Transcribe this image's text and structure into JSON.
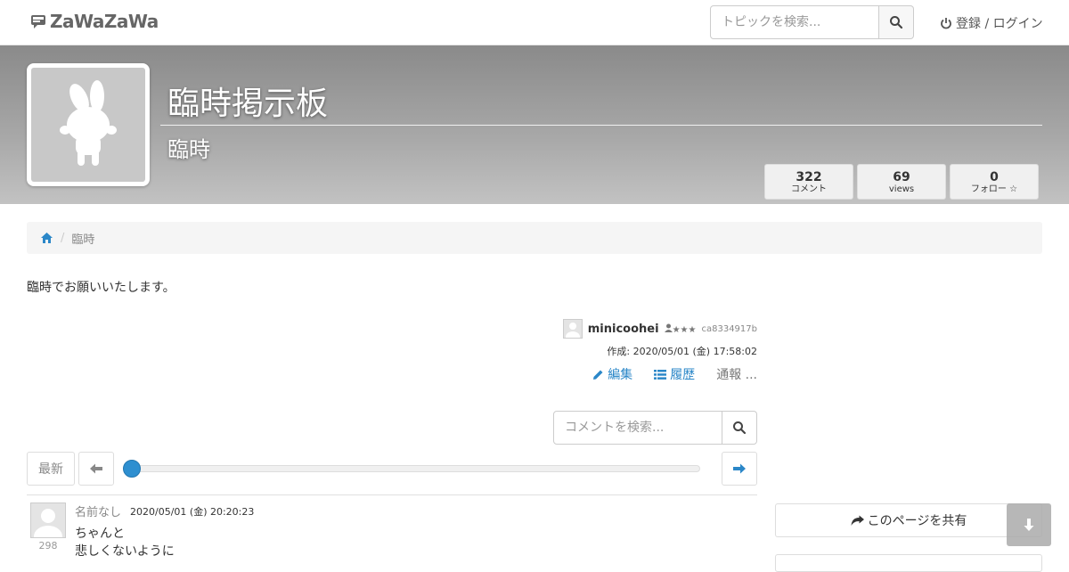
{
  "nav": {
    "logo_text": "ZaWaZaWa",
    "search_placeholder": "トピックを検索...",
    "login_label": "登録 / ログイン"
  },
  "board": {
    "title": "臨時掲示板",
    "subtitle": "臨時",
    "stats": [
      {
        "value": "322",
        "label": "コメント"
      },
      {
        "value": "69",
        "label": "views"
      },
      {
        "value": "0",
        "label": "フォロー ☆"
      }
    ]
  },
  "breadcrumb": {
    "current": "臨時"
  },
  "description": "臨時でお願いいたします。",
  "creator": {
    "name": "minicoohei",
    "rank": "★★★",
    "id": "ca8334917b",
    "created": "作成: 2020/05/01 (金) 17:58:02"
  },
  "actions": {
    "edit": "編集",
    "history": "履歴",
    "report": "通報 ..."
  },
  "comment_search": {
    "placeholder": "コメントを検索..."
  },
  "pager": {
    "latest_label": "最新",
    "position": 0
  },
  "comment": {
    "number": "298",
    "name": "名前なし",
    "date": "2020/05/01 (金) 20:20:23",
    "lines": [
      "ちゃんと",
      "悲しくないように"
    ]
  },
  "sidebar": {
    "share_label": "このページを共有"
  },
  "colors": {
    "accent": "#2b87c8",
    "banner_top": "#8a8a8a",
    "banner_bottom": "#c2c2c2"
  }
}
